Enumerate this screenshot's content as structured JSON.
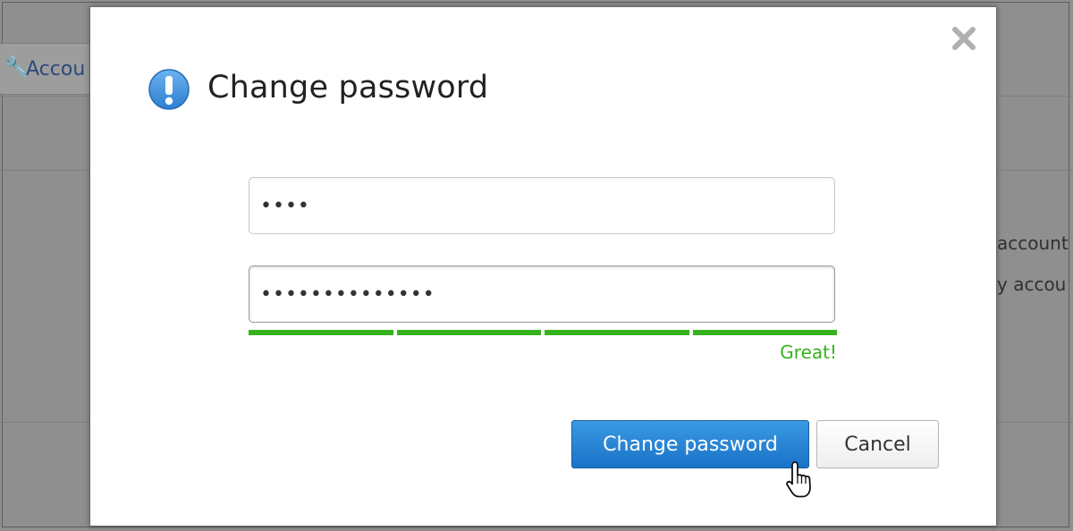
{
  "background": {
    "tab_label": "Accou",
    "text_lines": [
      "account",
      "y accou"
    ]
  },
  "modal": {
    "title": "Change password",
    "icon": "info-exclamation-icon",
    "close_icon": "close-icon",
    "current_password": {
      "value": "••••",
      "placeholder": ""
    },
    "new_password": {
      "value": "••••••••••••••",
      "placeholder": ""
    },
    "strength": {
      "label": "Great!",
      "level_fraction": 1.0,
      "segments": 4,
      "color": "#35b21d"
    },
    "buttons": {
      "primary_label": "Change password",
      "secondary_label": "Cancel"
    }
  },
  "colors": {
    "primary_button": "#2686d6",
    "strength_ok": "#35b21d",
    "info_icon": "#3f8fdc"
  }
}
